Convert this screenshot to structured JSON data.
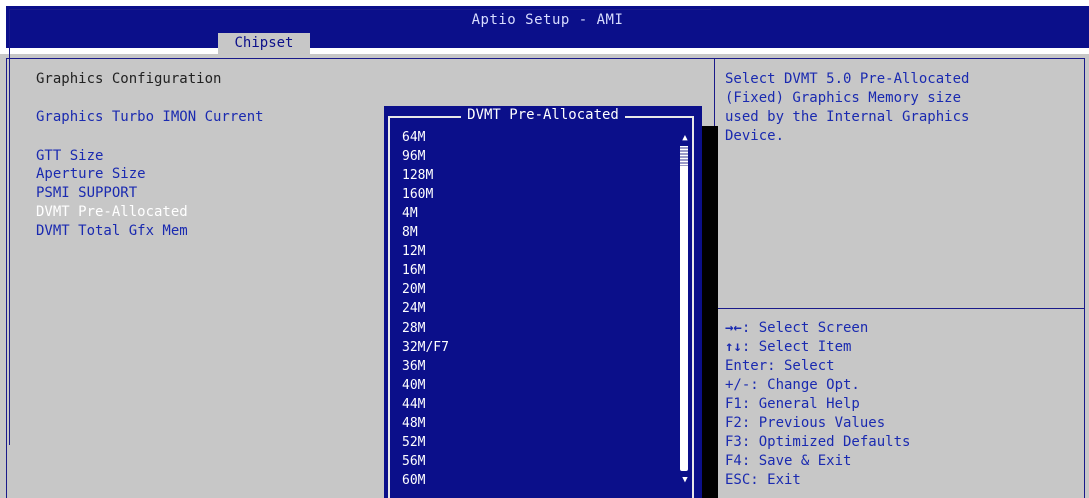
{
  "header": {
    "title": "Aptio Setup - AMI",
    "tabs": [
      {
        "label": "Chipset"
      }
    ]
  },
  "left": {
    "section_title": "Graphics Configuration",
    "items": [
      {
        "label": "Graphics Turbo IMON Current"
      },
      {
        "label": "GTT Size"
      },
      {
        "label": "Aperture Size"
      },
      {
        "label": "PSMI SUPPORT"
      },
      {
        "label": "DVMT Pre-Allocated"
      },
      {
        "label": "DVMT Total Gfx Mem"
      }
    ]
  },
  "popup": {
    "title": "DVMT Pre-Allocated",
    "options": [
      "64M",
      "96M",
      "128M",
      "160M",
      "4M",
      "8M",
      "12M",
      "16M",
      "20M",
      "24M",
      "28M",
      "32M/F7",
      "36M",
      "40M",
      "44M",
      "48M",
      "52M",
      "56M",
      "60M"
    ],
    "selected": "60M",
    "scroll_up_icon": "arrow-up",
    "scroll_down_icon": "arrow-down"
  },
  "help": {
    "description_lines": [
      "Select DVMT 5.0 Pre-Allocated",
      "(Fixed) Graphics Memory size",
      "used by the Internal Graphics",
      "Device."
    ]
  },
  "keys": [
    {
      "key": "→←",
      "desc": ": Select Screen"
    },
    {
      "key": "↑↓",
      "desc": ": Select Item"
    },
    {
      "key": "",
      "desc": "Enter: Select"
    },
    {
      "key": "",
      "desc": "+/-: Change Opt."
    },
    {
      "key": "",
      "desc": "F1: General Help"
    },
    {
      "key": "",
      "desc": "F2: Previous Values"
    },
    {
      "key": "",
      "desc": "F3: Optimized Defaults"
    },
    {
      "key": "",
      "desc": "F4: Save & Exit"
    },
    {
      "key": "",
      "desc": "ESC: Exit"
    }
  ],
  "colors": {
    "header_bg": "#0b0f8a",
    "panel_bg": "#c7c7c7",
    "text_blue": "#1a2ab0",
    "popup_bg": "#0b0f8a"
  }
}
